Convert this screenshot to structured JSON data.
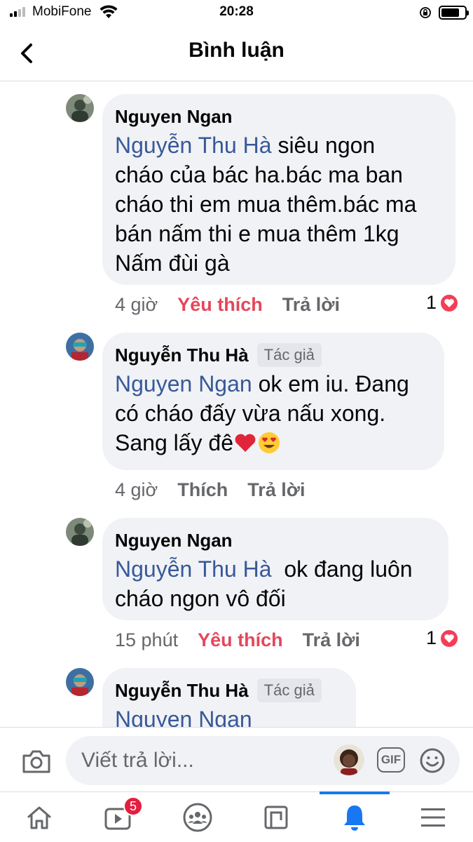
{
  "status_bar": {
    "carrier": "MobiFone",
    "time": "20:28",
    "battery_percent": 80
  },
  "header": {
    "title": "Bình luận"
  },
  "comments": [
    {
      "author": "Nguyen Ngan",
      "mention": "Nguyễn Thu Hà",
      "lines": [
        "siêu ngon",
        "cháo của bác ha.bác ma ban",
        "cháo thi em mua thêm.bác ma",
        "bán nấm thi e mua thêm 1kg",
        "Nấm đùi gà"
      ],
      "time": "4 giờ",
      "like_label": "Yêu thích",
      "reply_label": "Trả lời",
      "reaction_count": "1"
    },
    {
      "author": "Nguyễn Thu Hà",
      "badge": "Tác giả",
      "mention": "Nguyen Ngan",
      "lines": [
        "ok em iu. Đang",
        "có cháo đấy vừa nấu xong.",
        "Sang lấy đê"
      ],
      "time": "4 giờ",
      "like_label": "Thích",
      "reply_label": "Trả lời"
    },
    {
      "author": "Nguyen Ngan",
      "mention": "Nguyễn Thu Hà",
      "lines": [
        "ok đang luôn",
        "cháo ngon vô đối"
      ],
      "time": "15 phút",
      "like_label": "Yêu thích",
      "reply_label": "Trả lời",
      "reaction_count": "1"
    },
    {
      "author": "Nguyễn Thu Hà",
      "badge": "Tác giả",
      "mention": "Nguyen Ngan"
    }
  ],
  "composer": {
    "placeholder": "Viết trả lời...",
    "gif_label": "GIF"
  },
  "tabbar": {
    "watch_badge": "5"
  },
  "icons": {
    "back": "chevron-left-icon",
    "camera": "camera-icon",
    "emoji": "smiley-icon",
    "home": "home-icon",
    "watch": "video-icon",
    "groups": "groups-icon",
    "pages": "pages-icon",
    "notifications": "bell-icon",
    "menu": "menu-icon"
  },
  "colors": {
    "accent": "#1877f2",
    "mention": "#385898",
    "love": "#e4475a",
    "badge": "#e41e3f"
  }
}
